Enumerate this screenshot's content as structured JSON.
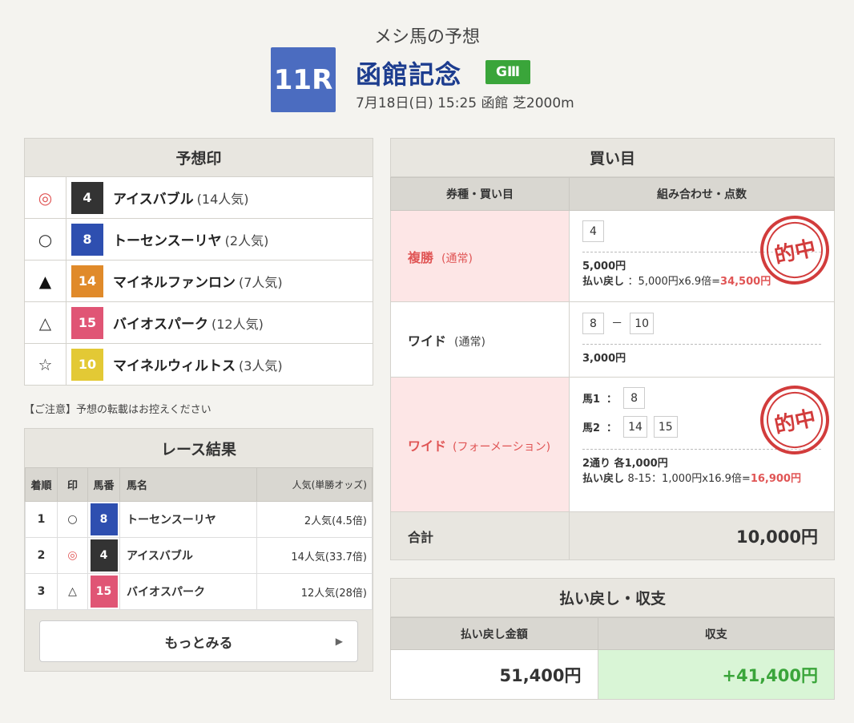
{
  "header": {
    "subtitle": "メシ馬の予想",
    "race_no": "11R",
    "race_name": "函館記念",
    "grade": "GⅢ",
    "info": "7月18日(日) 15:25 函館 芝2000m"
  },
  "prediction": {
    "title": "予想印",
    "rows": [
      {
        "mark": "◎",
        "num": "4",
        "name": "アイスバブル",
        "pop": "(14人気)",
        "color": "#333333",
        "markcolor": "#e05555"
      },
      {
        "mark": "○",
        "num": "8",
        "name": "トーセンスーリヤ",
        "pop": "(2人気)",
        "color": "#2e4fb0",
        "markcolor": "#333333"
      },
      {
        "mark": "▲",
        "num": "14",
        "name": "マイネルファンロン",
        "pop": "(7人気)",
        "color": "#e08a2a",
        "markcolor": "#111111"
      },
      {
        "mark": "△",
        "num": "15",
        "name": "バイオスパーク",
        "pop": "(12人気)",
        "color": "#e05575",
        "markcolor": "#333333"
      },
      {
        "mark": "☆",
        "num": "10",
        "name": "マイネルウィルトス",
        "pop": "(3人気)",
        "color": "#e3c935",
        "markcolor": "#333333"
      }
    ]
  },
  "note": "【ご注意】予想の転載はお控えください",
  "results": {
    "title": "レース結果",
    "headers": {
      "rank": "着順",
      "mark": "印",
      "num": "馬番",
      "name": "馬名",
      "odds": "人気(単勝オッズ)"
    },
    "rows": [
      {
        "rank": "1",
        "mark": "○",
        "num": "8",
        "name": "トーセンスーリヤ",
        "odds": "2人気(4.5倍)"
      },
      {
        "rank": "2",
        "mark": "◎",
        "num": "4",
        "name": "アイスバブル",
        "odds": "14人気(33.7倍)"
      },
      {
        "rank": "3",
        "mark": "△",
        "num": "15",
        "name": "バイオスパーク",
        "odds": "12人気(28倍)"
      }
    ],
    "more": "もっとみる",
    "more_arrow": "▶"
  },
  "bets": {
    "title": "買い目",
    "col1": "券種・買い目",
    "col2": "組み合わせ・点数",
    "b1": {
      "type": "複勝",
      "sub": "(通常)",
      "box1": "4",
      "amount": "5,000円",
      "pay_label": "払い戻し",
      "pay_calc": "：5,000円x6.9倍=",
      "pay_value": "34,500円",
      "stamp": "的中"
    },
    "b2": {
      "type": "ワイド",
      "sub": "(通常)",
      "box1": "8",
      "sep": "－",
      "box2": "10",
      "amount": "3,000円"
    },
    "b3": {
      "type": "ワイド",
      "sub": "(フォーメーション)",
      "h1": "馬1",
      "colon": "：",
      "h1a": "8",
      "h2": "馬2",
      "h2a": "14",
      "h2b": "15",
      "amount": "2通り 各1,000円",
      "pay_label": "払い戻し",
      "pay_calc": "8-15：1,000円x16.9倍=",
      "pay_value": "16,900円",
      "stamp": "的中"
    },
    "total_label": "合計",
    "total_value": "10,000円"
  },
  "payout": {
    "title": "払い戻し・収支",
    "col1": "払い戻し金額",
    "col2": "収支",
    "v1": "51,400円",
    "v2": "+41,400円"
  }
}
